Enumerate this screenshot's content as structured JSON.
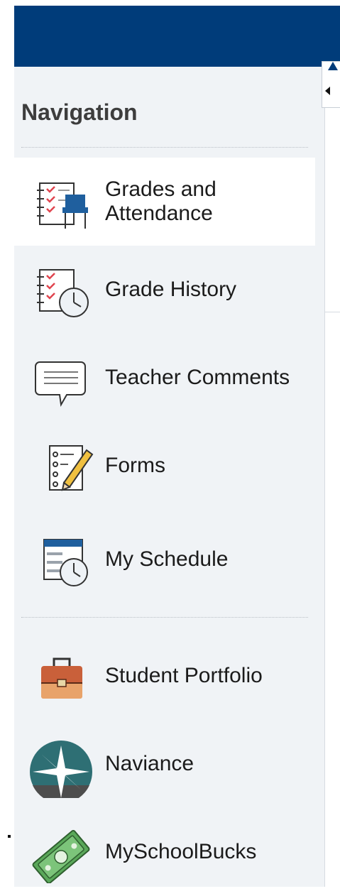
{
  "navigation": {
    "title": "Navigation",
    "items": [
      {
        "label": "Grades and Attendance",
        "icon": "grades-attendance-icon",
        "active": true
      },
      {
        "label": "Grade History",
        "icon": "grade-history-icon"
      },
      {
        "label": "Teacher Comments",
        "icon": "teacher-comments-icon"
      },
      {
        "label": "Forms",
        "icon": "forms-icon"
      },
      {
        "label": "My Schedule",
        "icon": "my-schedule-icon"
      },
      {
        "label": "Student Portfolio",
        "icon": "student-portfolio-icon"
      },
      {
        "label": "Naviance",
        "icon": "naviance-icon"
      },
      {
        "label": "MySchoolBucks",
        "icon": "myschoolbucks-icon"
      }
    ]
  },
  "colors": {
    "header": "#003c7a",
    "sidebar_bg": "#f0f3f6",
    "active_item_bg": "#ffffff",
    "check_red": "#e0454f",
    "portfolio_orange": "#c9603a",
    "naviance_teal": "#2e6f74",
    "money_green": "#5aa85a"
  }
}
